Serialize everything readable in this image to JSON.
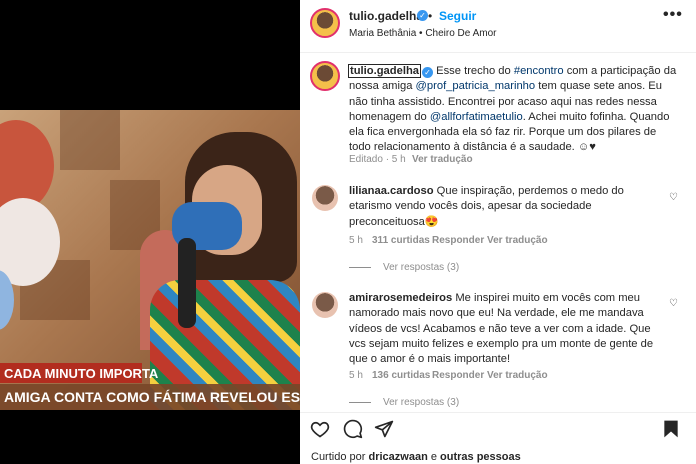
{
  "post": {
    "username": "tulio.gadelha",
    "follow_label": "Seguir",
    "separator": "•",
    "audio": "Maria Bethânia • Cheiro De Amor",
    "more_label": "•••"
  },
  "video": {
    "caption_top": "CADA MINUTO IMPORTA",
    "caption_bottom": "AMIGA CONTA COMO FÁTIMA REVELOU ESTAR A"
  },
  "caption": {
    "username": "tulio.gadelha",
    "text_1": " Esse trecho do ",
    "hashtag": "#encontro",
    "text_2": " com a participação da nossa amiga ",
    "mention_1": "@prof_patricia_marinho",
    "text_3": " tem quase sete anos. Eu não tinha assistido. Encontrei por acaso aqui nas redes nessa homenagem do ",
    "mention_2": "@allforfatimaetulio",
    "text_4": ". Achei muito fofinha. Quando ela fica envergonhada ela só faz rir. Porque um dos pilares de todo relacionamento à distância é a saudade. ☺♥",
    "edited": "Editado · 5 h",
    "see_translation": "Ver tradução"
  },
  "comments": [
    {
      "username": "lilianaa.cardoso",
      "text": " Que inspiração, perdemos o medo do etarismo vendo vocês dois, apesar da sociedade preconceituosa😍",
      "time": "5 h",
      "likes": "311 curtidas",
      "reply": "Responder",
      "translate": "Ver tradução",
      "view_replies": "Ver respostas (3)"
    },
    {
      "username": "amirarosemedeiros",
      "text": " Me inspirei muito em vocês com meu namorado mais novo que eu! Na verdade, ele me mandava vídeos de vcs! Acabamos e não teve a ver com a idade. Que vcs sejam muito felizes e exemplo pra um monte de gente de que o amor é o mais importante!",
      "time": "5 h",
      "likes": "136 curtidas",
      "reply": "Responder",
      "translate": "Ver tradução",
      "view_replies": "Ver respostas (3)"
    }
  ],
  "footer": {
    "liked_by_prefix": "Curtido por ",
    "liked_user": "dricazwaan",
    "liked_and": " e ",
    "liked_others": "outras pessoas"
  },
  "icons": {
    "like": "heart-outline-icon",
    "comment": "comment-bubble-icon",
    "share": "paper-plane-icon",
    "save": "bookmark-icon",
    "verified": "verified-badge-icon"
  },
  "colors": {
    "accent": "#0095f6",
    "verified": "#3897f0",
    "muted": "#8e8e8e",
    "caption_red": "#b22d1f"
  }
}
